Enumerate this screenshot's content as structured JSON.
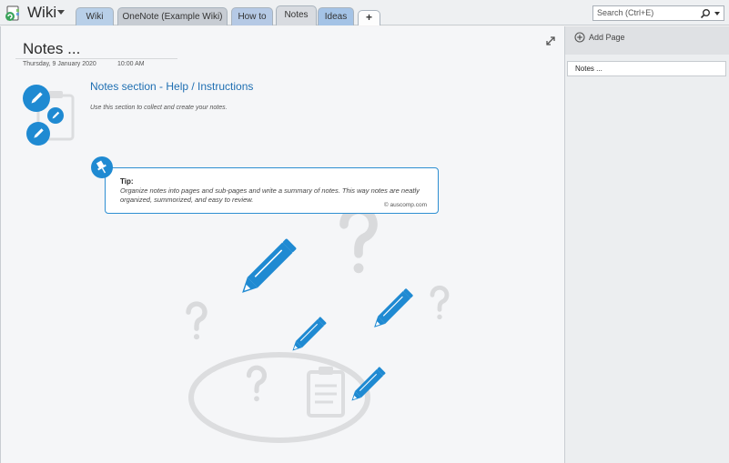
{
  "notebook": {
    "title": "Wiki"
  },
  "tabs": [
    {
      "label": "Wiki"
    },
    {
      "label": "OneNote (Example Wiki)"
    },
    {
      "label": "How to"
    },
    {
      "label": "Notes"
    },
    {
      "label": "Ideas"
    },
    {
      "label": "+"
    }
  ],
  "search": {
    "placeholder": "Search (Ctrl+E)"
  },
  "page": {
    "title": "Notes ...",
    "date": "Thursday, 9 January 2020",
    "time": "10:00 AM",
    "section_heading": "Notes section - Help / Instructions",
    "section_description": "Use this section to collect and create your notes.",
    "tip_label": "Tip:",
    "tip_body": "Organize notes into pages and sub-pages and write a summary of notes. This way notes are neatly organized, summorized, and easy to review.",
    "tip_credit": "auscomp.com"
  },
  "sidebar": {
    "add_page_label": "Add Page",
    "pages": [
      {
        "label": "Notes ..."
      }
    ]
  },
  "colors": {
    "accent": "#1f8ad2",
    "heading": "#1f6fb2",
    "watermark": "#d9dadc"
  },
  "icons": [
    "onenote-icon",
    "search-icon",
    "expand-icon",
    "pencil-icon",
    "pin-icon",
    "add-page-icon",
    "question-mark-icon",
    "clipboard-icon"
  ]
}
